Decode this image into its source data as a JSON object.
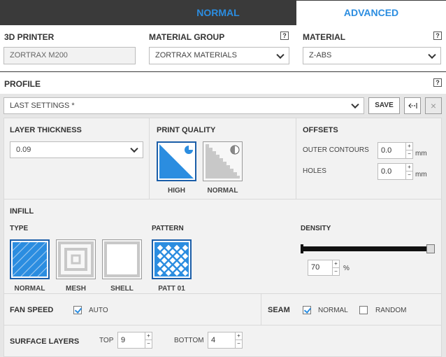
{
  "modes": {
    "normal": "NORMAL",
    "advanced": "ADVANCED"
  },
  "printer": {
    "label": "3D PRINTER",
    "value": "ZORTRAX M200"
  },
  "material_group": {
    "label": "MATERIAL GROUP",
    "value": "ZORTRAX MATERIALS"
  },
  "material": {
    "label": "MATERIAL",
    "value": "Z-ABS"
  },
  "help_glyph": "?",
  "profile": {
    "label": "PROFILE",
    "value": "LAST SETTINGS *",
    "save": "SAVE",
    "close": "×"
  },
  "layer": {
    "label": "LAYER THICKNESS",
    "value": "0.09"
  },
  "quality": {
    "label": "PRINT QUALITY",
    "high": "HIGH",
    "normal": "NORMAL"
  },
  "offsets": {
    "label": "OFFSETS",
    "outer_label": "OUTER CONTOURS",
    "outer_value": "0.0",
    "holes_label": "HOLES",
    "holes_value": "0.0",
    "unit": "mm"
  },
  "infill": {
    "label": "INFILL",
    "type_label": "TYPE",
    "types": [
      "NORMAL",
      "MESH",
      "SHELL"
    ],
    "pattern_label": "PATTERN",
    "pattern": "PATT 01",
    "density_label": "DENSITY",
    "density_value": "70",
    "density_unit": "%",
    "density_fraction": 1.0
  },
  "fan": {
    "label": "FAN SPEED",
    "auto": "AUTO"
  },
  "seam": {
    "label": "SEAM",
    "normal": "NORMAL",
    "random": "RANDOM"
  },
  "surface": {
    "label": "SURFACE LAYERS",
    "top_label": "TOP",
    "top_value": "9",
    "bottom_label": "BOTTOM",
    "bottom_value": "4"
  },
  "spin_up": "+",
  "spin_down": "−",
  "colors": {
    "accent": "#2b8de0",
    "dark_bar": "#3a3a3a",
    "panel": "#f2f2f2"
  }
}
